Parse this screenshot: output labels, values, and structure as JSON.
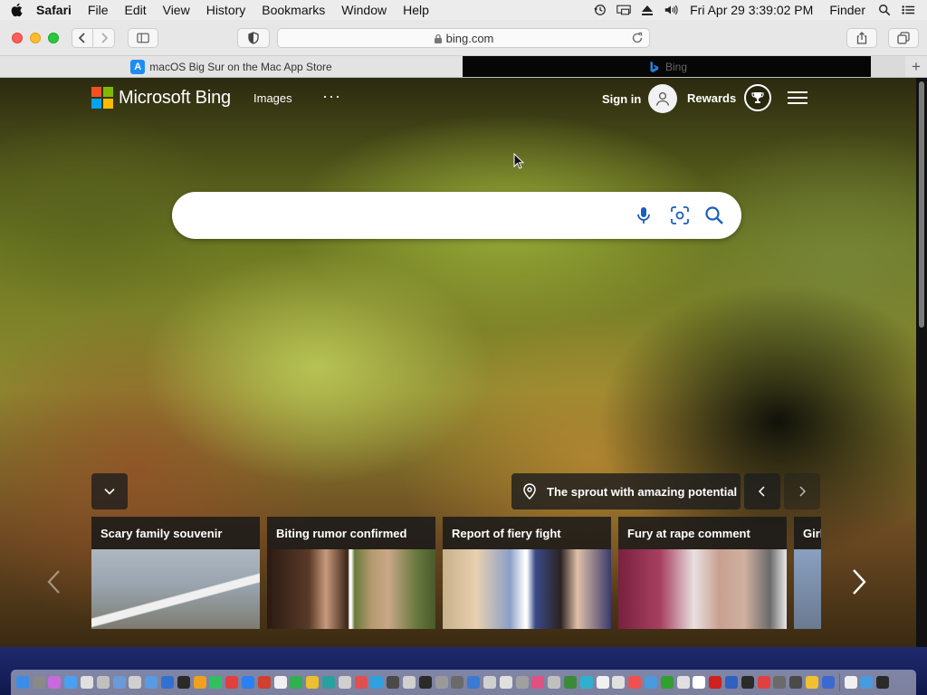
{
  "menubar": {
    "app_name": "Safari",
    "items": [
      "File",
      "Edit",
      "View",
      "History",
      "Bookmarks",
      "Window",
      "Help"
    ],
    "clock": "Fri Apr 29  3:39:02 PM",
    "finder": "Finder",
    "status_icons": [
      "time-machine-icon",
      "display-mirroring-icon",
      "eject-icon",
      "volume-icon"
    ]
  },
  "toolbar": {
    "url": "bing.com"
  },
  "tabs": [
    {
      "title": "macOS Big Sur on the Mac App Store",
      "favicon": "app-store-icon"
    },
    {
      "title": "Bing",
      "favicon": "bing-icon"
    }
  ],
  "bing": {
    "logo_text": "Microsoft Bing",
    "nav_images": "Images",
    "nav_more": "···",
    "signin": "Sign in",
    "rewards": "Rewards",
    "search": {
      "value": "",
      "placeholder": ""
    },
    "image_info": "The sprout with amazing potential",
    "news": [
      {
        "title": "Scary family souvenir"
      },
      {
        "title": "Biting rumor confirmed"
      },
      {
        "title": "Report of fiery fight"
      },
      {
        "title": "Fury at rape comment"
      },
      {
        "title": "Girl"
      }
    ]
  },
  "colors": {
    "ms_red": "#f25022",
    "ms_green": "#7fba00",
    "ms_blue": "#00a4ef",
    "ms_yellow": "#ffb900",
    "search_icon_blue": "#1a5ebd"
  },
  "dock": {
    "icon_colors": [
      "#3a8ee8",
      "#8a8a8a",
      "#c86adc",
      "#4aa0f0",
      "#e0e0e0",
      "#c0c0c0",
      "#6a9ad8",
      "#d0d0d0",
      "#5a9ae0",
      "#3070d0",
      "#2a2a2a",
      "#f0a020",
      "#30c060",
      "#e04040",
      "#2a80f0",
      "#d04030",
      "#f0f0f0",
      "#30b050",
      "#e8c030",
      "#2aa0a0",
      "#d0d0d0",
      "#e05050",
      "#30a0e0",
      "#4a4a4a",
      "#d0d0d0",
      "#2a2a2a",
      "#9a9a9a",
      "#6a6a6a",
      "#3a7ad0",
      "#d0d0d0",
      "#e0e0e0",
      "#a0a0a0",
      "#e05080",
      "#c0c0c0",
      "#3a8a3a",
      "#30b0d0",
      "#f0f0f0",
      "#e0e0e0",
      "#f05050",
      "#4a9ae0",
      "#30a030",
      "#e0e0e0",
      "#ffffff",
      "#d02020",
      "#3060c0",
      "#2a2a2a",
      "#e04040",
      "#6a6a6a",
      "#4a4a4a",
      "#f0c030",
      "#3a6ad0",
      "#f0f0f0",
      "#4a9ae0",
      "#2a2a2a"
    ]
  }
}
